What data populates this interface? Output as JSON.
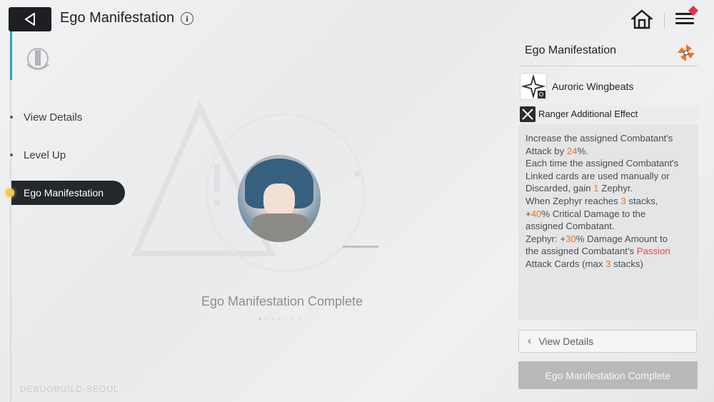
{
  "header": {
    "title": "Ego Manifestation",
    "info_glyph": "i"
  },
  "nav": {
    "items": [
      {
        "label": "View Details"
      },
      {
        "label": "Level Up"
      },
      {
        "label": "Ego Manifestation"
      }
    ],
    "active_index": 2
  },
  "center": {
    "status_text": "Ego Manifestation Complete",
    "page_dots": "● ○ ○ ○ ○ ○ ○"
  },
  "watermark": "DEBUGBUILD-SEOUL",
  "panel": {
    "title": "Ego Manifestation",
    "skill_name": "Auroric Wingbeats",
    "effect_label": "Ranger Additional Effect",
    "description": {
      "l1": "Increase the assigned Combatant's",
      "l2a": "Attack by ",
      "l2v": "24",
      "l2b": "%.",
      "l3": "Each time the assigned Combatant's",
      "l4": "Linked cards are used manually or",
      "l5a": "Discarded, gain ",
      "l5v": "1",
      "l5b": " Zephyr.",
      "l6a": "When Zephyr reaches ",
      "l6v": "3",
      "l6b": " stacks,",
      "l7a": "+",
      "l7v": "40",
      "l7b": "% Critical Damage to the",
      "l8": "assigned Combatant.",
      "l9a": "Zephyr: +",
      "l9v": "30",
      "l9b": "% Damage Amount to",
      "l10a": "the assigned Combatant's ",
      "l10v": "Passion",
      "l11a": "Attack Cards (max ",
      "l11v": "3",
      "l11b": " stacks)"
    }
  },
  "buttons": {
    "view_details": "View Details",
    "complete": "Ego Manifestation Complete"
  },
  "colors": {
    "accent_orange": "#e8742a",
    "accent_red": "#e0484e",
    "teal": "#2aa6b8",
    "dark": "#24272b"
  },
  "icons": [
    "back-arrow-icon",
    "info-icon",
    "home-icon",
    "menu-icon",
    "emblem-icon",
    "pinwheel-logo-icon",
    "sparkle-skill-icon",
    "crossed-swords-icon",
    "chevron-left-icon"
  ]
}
